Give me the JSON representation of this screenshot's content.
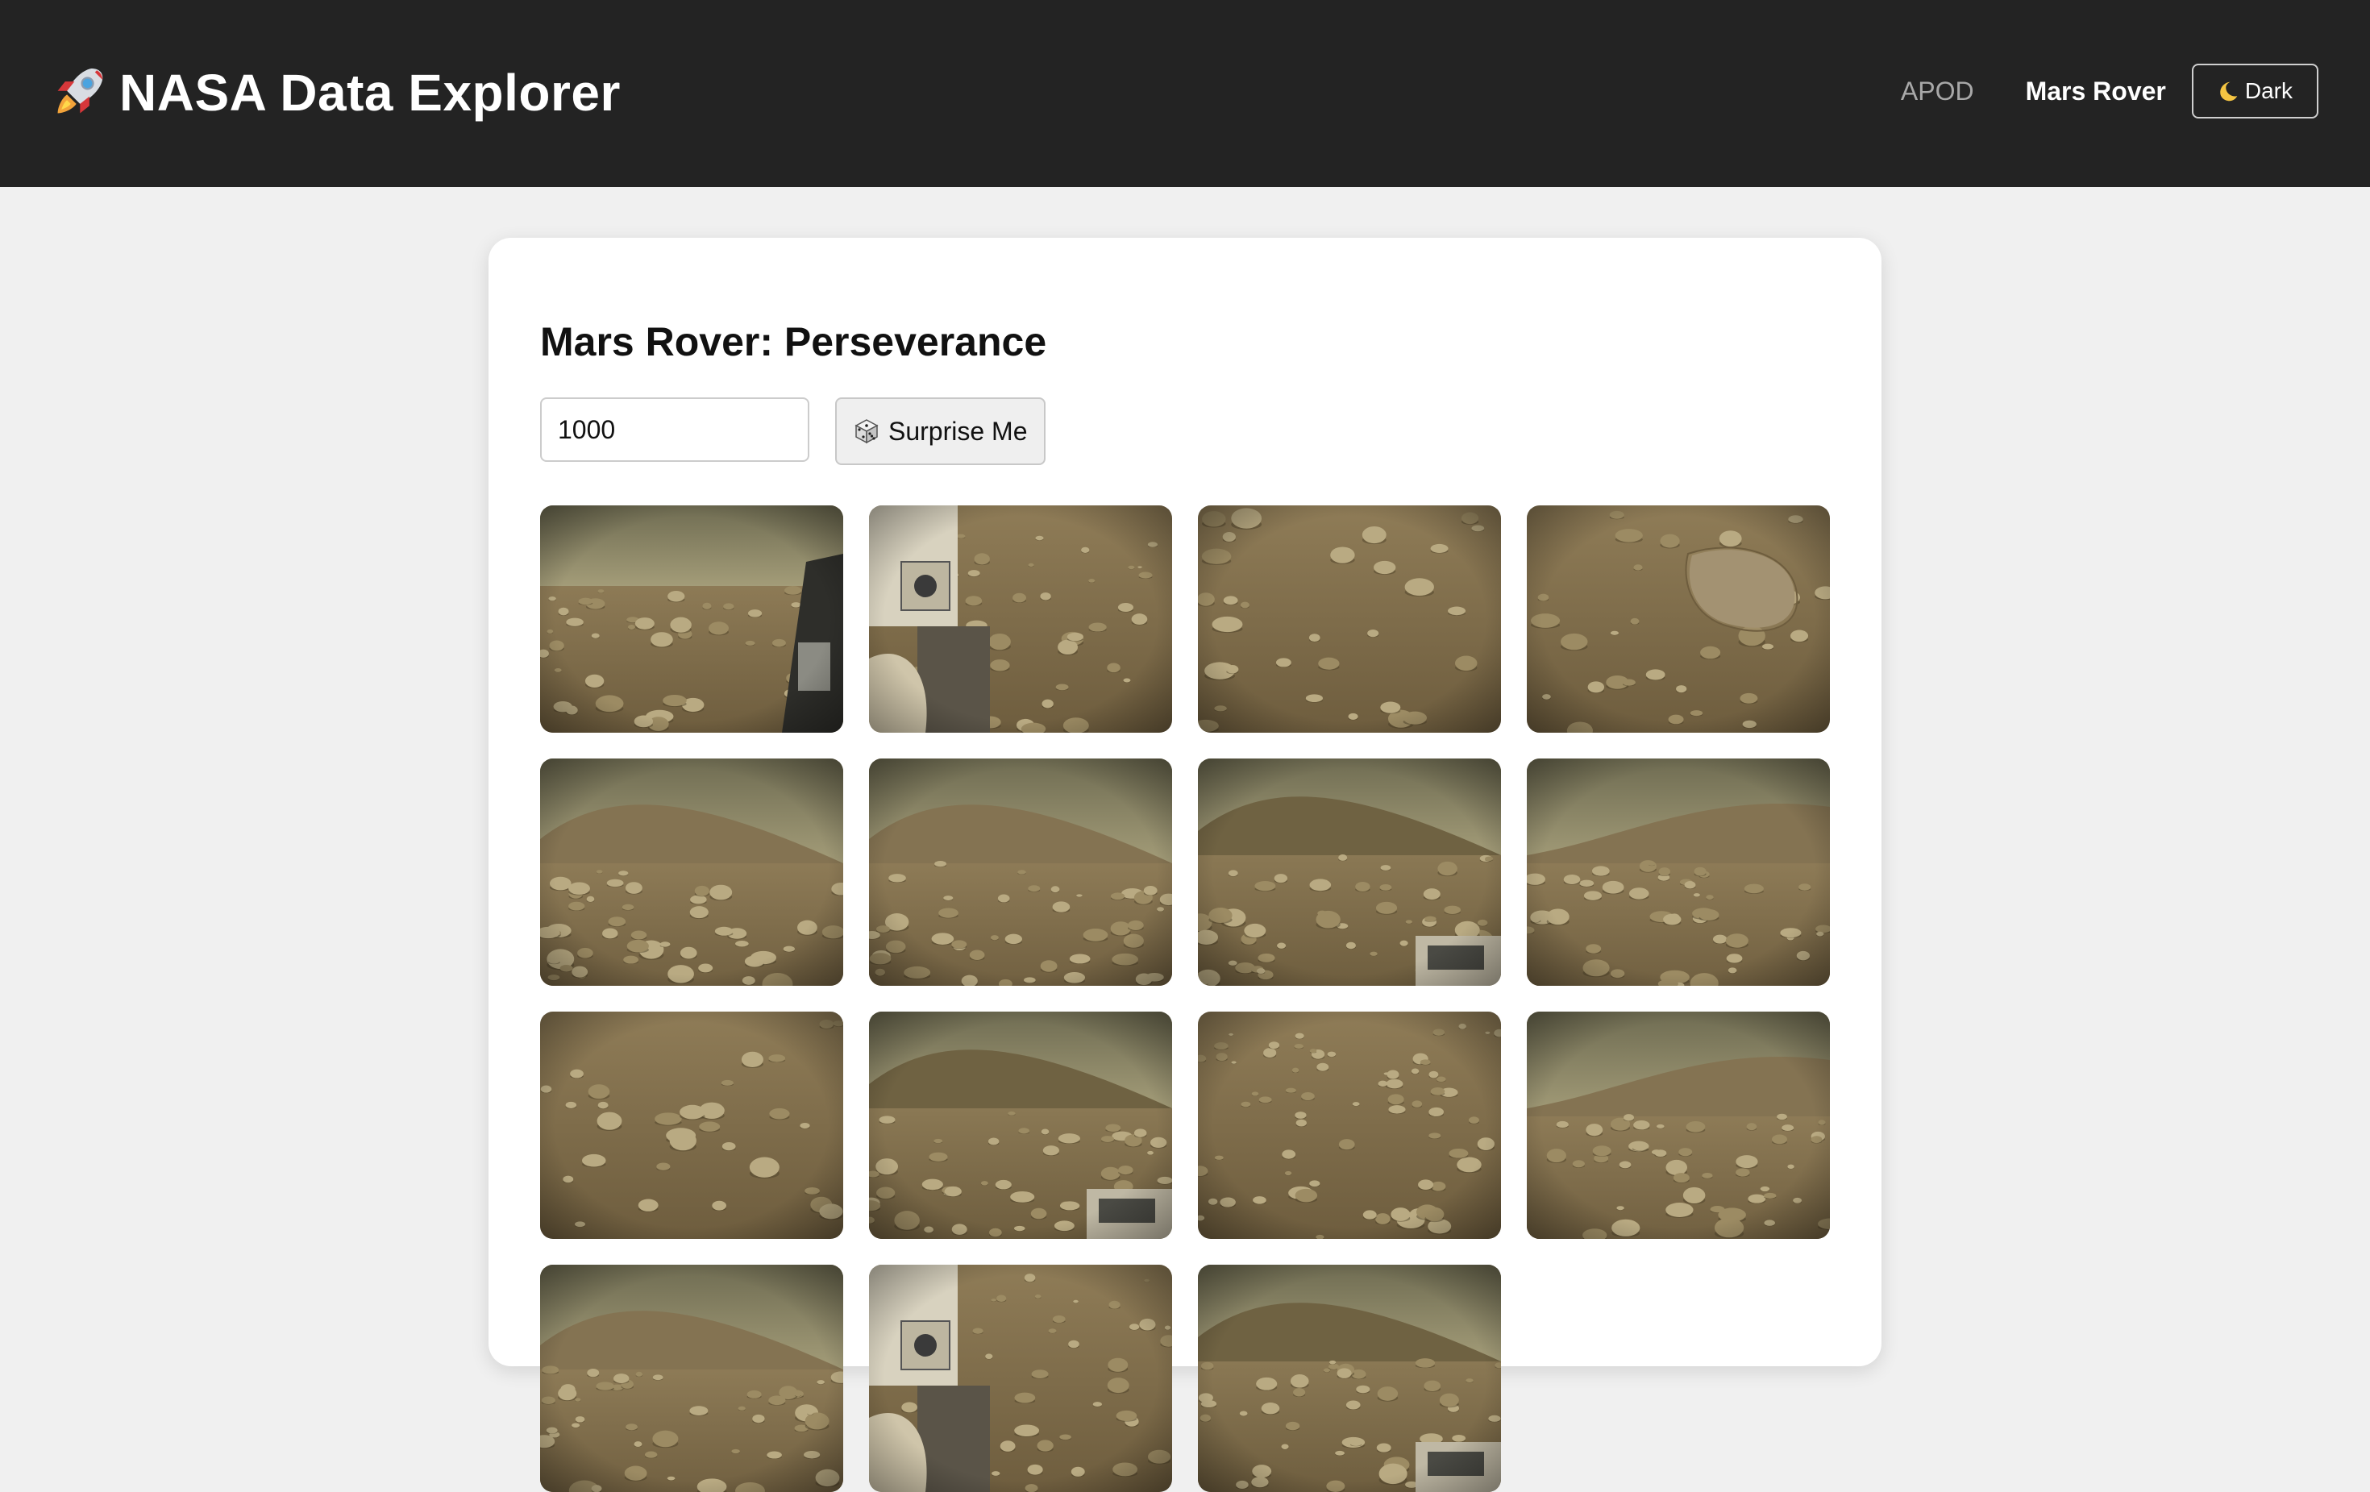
{
  "header": {
    "title": "NASA Data Explorer",
    "brand_icon": "rocket-icon",
    "nav": [
      {
        "label": "APOD",
        "active": false
      },
      {
        "label": "Mars Rover",
        "active": true
      }
    ],
    "theme_button": {
      "label": "Dark",
      "icon": "moon-icon"
    }
  },
  "main": {
    "title": "Mars Rover: Perseverance",
    "sol_input": {
      "value": "1000"
    },
    "surprise_button": {
      "label": "Surprise Me",
      "icon": "die-icon"
    },
    "photos": [
      {
        "scene": "horizon-rocks",
        "rover_part": true
      },
      {
        "scene": "rover-deck",
        "rover_part": true
      },
      {
        "scene": "close-rocks",
        "rover_part": false
      },
      {
        "scene": "flat-boulder",
        "rover_part": false
      },
      {
        "scene": "hill",
        "rover_part": false
      },
      {
        "scene": "hill",
        "rover_part": false
      },
      {
        "scene": "hill-dark",
        "rover_part": true
      },
      {
        "scene": "hill-right",
        "rover_part": false
      },
      {
        "scene": "close-rocks",
        "rover_part": false
      },
      {
        "scene": "hill-dark",
        "rover_part": true
      },
      {
        "scene": "rocky-field",
        "rover_part": false
      },
      {
        "scene": "hill-right",
        "rover_part": false
      },
      {
        "scene": "hill",
        "rover_part": false
      },
      {
        "scene": "rover-deck",
        "rover_part": true
      },
      {
        "scene": "hill-dark",
        "rover_part": true
      }
    ]
  },
  "colors": {
    "topbar": "#232323",
    "page_bg": "#f0f0f0",
    "card_bg": "#ffffff",
    "mars_sky": "#8f8a6a",
    "mars_ground": "#8a7550"
  }
}
